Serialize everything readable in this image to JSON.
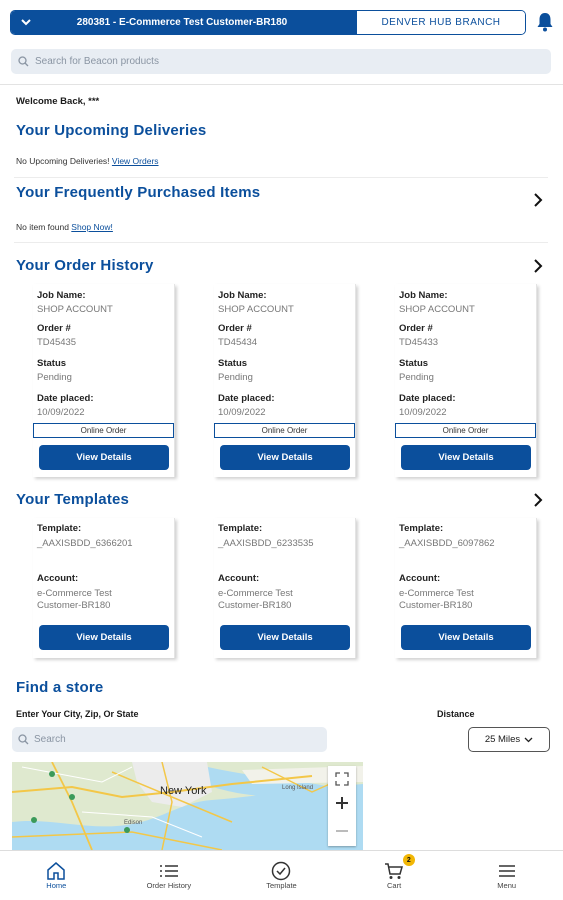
{
  "header": {
    "account": "280381 - E-Commerce Test Customer-BR180",
    "branch": "DENVER HUB BRANCH"
  },
  "search": {
    "placeholder": "Search for Beacon products"
  },
  "welcome": "Welcome Back, ***",
  "deliveries": {
    "title": "Your Upcoming Deliveries",
    "empty": "No Upcoming Deliveries!",
    "link": "View Orders"
  },
  "frequent": {
    "title": "Your Frequently Purchased Items",
    "empty": "No item found",
    "link": "Shop Now!"
  },
  "orders": {
    "title": "Your Order History",
    "labels": {
      "job": "Job Name:",
      "order": "Order #",
      "status": "Status",
      "date": "Date placed:"
    },
    "button": "View Details",
    "items": [
      {
        "job": "SHOP ACCOUNT",
        "order": "TD45435",
        "status": "Pending",
        "date": "10/09/2022",
        "tag": "Online Order"
      },
      {
        "job": "SHOP ACCOUNT",
        "order": "TD45434",
        "status": "Pending",
        "date": "10/09/2022",
        "tag": "Online Order"
      },
      {
        "job": "SHOP ACCOUNT",
        "order": "TD45433",
        "status": "Pending",
        "date": "10/09/2022",
        "tag": "Online Order"
      }
    ]
  },
  "templates": {
    "title": "Your Templates",
    "labels": {
      "template": "Template:",
      "account": "Account:"
    },
    "button": "View Details",
    "items": [
      {
        "template": "_AAXISBDD_6366201",
        "account_line1": "e-Commerce Test",
        "account_line2": "Customer-BR180"
      },
      {
        "template": "_AAXISBDD_6233535",
        "account_line1": "e-Commerce Test",
        "account_line2": "Customer-BR180"
      },
      {
        "template": "_AAXISBDD_6097862",
        "account_line1": "e-Commerce Test",
        "account_line2": "Customer-BR180"
      }
    ]
  },
  "store": {
    "title": "Find a store",
    "city_label": "Enter Your City, Zip, Or State",
    "distance_label": "Distance",
    "search_placeholder": "Search",
    "distance_value": "25 Miles",
    "map_city": "New York",
    "map_labels": [
      "Long Island",
      "Edison"
    ]
  },
  "bottom_nav": {
    "items": [
      {
        "label": "Home",
        "icon": "home-icon"
      },
      {
        "label": "Order History",
        "icon": "list-icon"
      },
      {
        "label": "Template",
        "icon": "check-circle-icon"
      },
      {
        "label": "Cart",
        "icon": "cart-icon"
      },
      {
        "label": "Menu",
        "icon": "hamburger-icon"
      }
    ],
    "cart_count": "2"
  },
  "colors": {
    "brand": "#0b4f9c",
    "badge": "#f2b705"
  }
}
